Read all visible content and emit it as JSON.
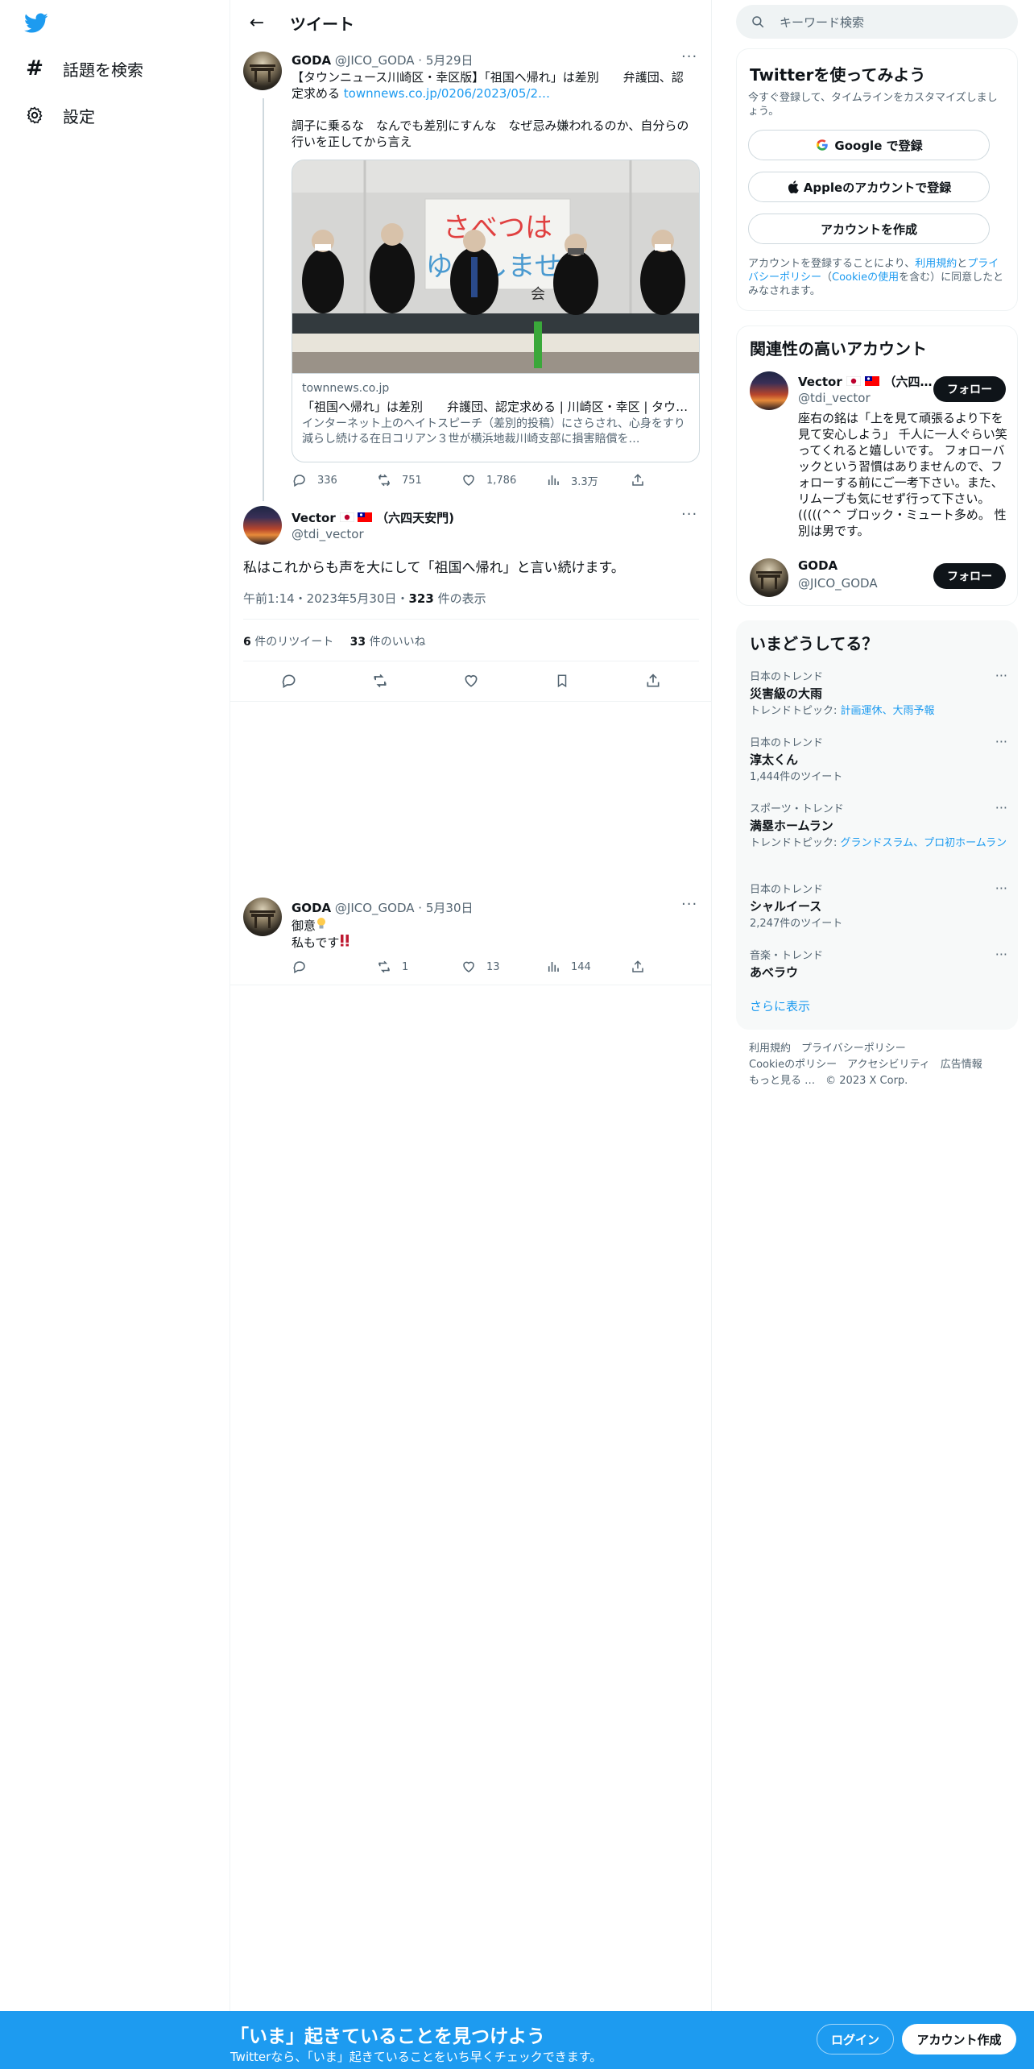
{
  "nav": {
    "explore_label": "話題を検索",
    "settings_label": "設定"
  },
  "header": {
    "title": "ツイート"
  },
  "parent_tweet": {
    "name": "GODA",
    "handle": "@JICO_GODA",
    "date": "5月29日",
    "line1": "【タウンニュース川崎区・幸区版】「祖国へ帰れ」は差別　　弁護団、認",
    "line2": "定求める",
    "link": "townnews.co.jp/0206/2023/05/2…",
    "line3": "調子に乗るな　なんでも差別にすんな　なぜ忌み嫌われるのか、自分らの",
    "line4": "行いを正してから言え",
    "card": {
      "banner_text1": "さべつは",
      "banner_text2": "ゆるしませ",
      "banner_text3": "会",
      "domain": "townnews.co.jp",
      "title": "「祖国へ帰れ」は差別　　弁護団、認定求める | 川崎区・幸区 | タウ…",
      "desc": "インターネット上のヘイトスピーチ（差別的投稿）にさらされ、心身をすり減らし続ける在日コリアン３世が横浜地裁川崎支部に損害賠償を…"
    },
    "stats": {
      "replies": "336",
      "retweets": "751",
      "likes": "1,786",
      "views": "3.3万"
    }
  },
  "main_tweet": {
    "name": "Vector",
    "name_suffix": "（六四天安門)",
    "handle": "@tdi_vector",
    "text": "私はこれからも声を大にして「祖国へ帰れ」と言い続けます。",
    "time": "午前1:14・2023年5月30日・",
    "views_count": "323",
    "views_label": " 件の表示",
    "retweets_count": "6",
    "retweets_label": " 件のリツイート",
    "likes_count": "33",
    "likes_label": " 件のいいね"
  },
  "reply_tweet": {
    "name": "GODA",
    "handle": "@JICO_GODA",
    "date": "5月30日",
    "line1": "御意",
    "line2": "私もです",
    "stats": {
      "replies": "",
      "retweets": "1",
      "likes": "13",
      "views": "144"
    }
  },
  "search": {
    "placeholder": "キーワード検索"
  },
  "signup_panel": {
    "title": "Twitterを使ってみよう",
    "subtitle": "今すぐ登録して、タイムラインをカスタマイズしましょう。",
    "google_label": "Google で登録",
    "apple_label": "Appleのアカウントで登録",
    "create_label": "アカウントを作成",
    "terms_pre": "アカウントを登録することにより、",
    "terms_link": "利用規約",
    "terms_and": "と",
    "privacy_link": "プライバシーポリシー",
    "cookie_pre": "（",
    "cookie_link": "Cookieの使用",
    "terms_post": "を含む）に同意したとみなされます。"
  },
  "related_panel": {
    "title": "関連性の高いアカウント",
    "accounts": [
      {
        "name": "Vector",
        "name_suffix": "（六四…",
        "handle": "@tdi_vector",
        "follow_label": "フォロー",
        "bio": "座右の銘は「上を見て頑張るより下を見て安心しよう」 千人に一人ぐらい笑ってくれると嬉しいです。 フォローバックという習慣はありませんので、フォローする前にご一考下さい。また、リムーブも気にせず行って下さい。(((((^^ ブロック・ミュート多め。 性別は男です。"
      },
      {
        "name": "GODA",
        "handle": "@JICO_GODA",
        "follow_label": "フォロー"
      }
    ]
  },
  "trends_panel": {
    "title": "いまどうしてる？",
    "trends": [
      {
        "context": "日本のトレンド",
        "name": "災害級の大雨",
        "sub_prefix": "トレンドトピック: ",
        "sub_links": "計画運休、大雨予報",
        "sub_plain": ""
      },
      {
        "context": "日本のトレンド",
        "name": "淳太くん",
        "sub_prefix": "",
        "sub_links": "",
        "sub_plain": "1,444件のツイート"
      },
      {
        "context": "スポーツ・トレンド",
        "name": "満塁ホームラン",
        "sub_prefix": "トレンドトピック: ",
        "sub_links": "グランドスラム、プロ初ホームラン",
        "sub_plain": ""
      },
      {
        "context": "日本のトレンド",
        "name": "シャルイース",
        "sub_prefix": "",
        "sub_links": "",
        "sub_plain": "2,247件のツイート"
      },
      {
        "context": "音楽・トレンド",
        "name": "あべラウ",
        "sub_prefix": "",
        "sub_links": "",
        "sub_plain": ""
      }
    ],
    "show_more": "さらに表示"
  },
  "footer": {
    "terms": "利用規約",
    "privacy": "プライバシーポリシー",
    "cookie": "Cookieのポリシー",
    "accessibility": "アクセシビリティ",
    "ads": "広告情報",
    "more": "もっと見る …",
    "copyright": "© 2023 X Corp."
  },
  "bottom_bar": {
    "title": "「いま」起きていることを見つけよう",
    "subtitle": "Twitterなら、「いま」起きていることをいち早くチェックできます。",
    "login_label": "ログイン",
    "signup_label": "アカウント作成"
  },
  "colors": {
    "accent": "#1d9bf0",
    "text": "#0f1419",
    "secondary": "#536471",
    "border": "#eff3f4"
  },
  "icons": {
    "logo": "twitter-bird-icon",
    "explore": "hashtag-icon",
    "settings": "gear-icon",
    "back": "arrow-left-icon",
    "search": "search-icon",
    "more": "more-icon",
    "reply": "reply-icon",
    "retweet": "retweet-icon",
    "like": "heart-icon",
    "views": "analytics-icon",
    "bookmark": "bookmark-icon",
    "share": "share-icon"
  }
}
